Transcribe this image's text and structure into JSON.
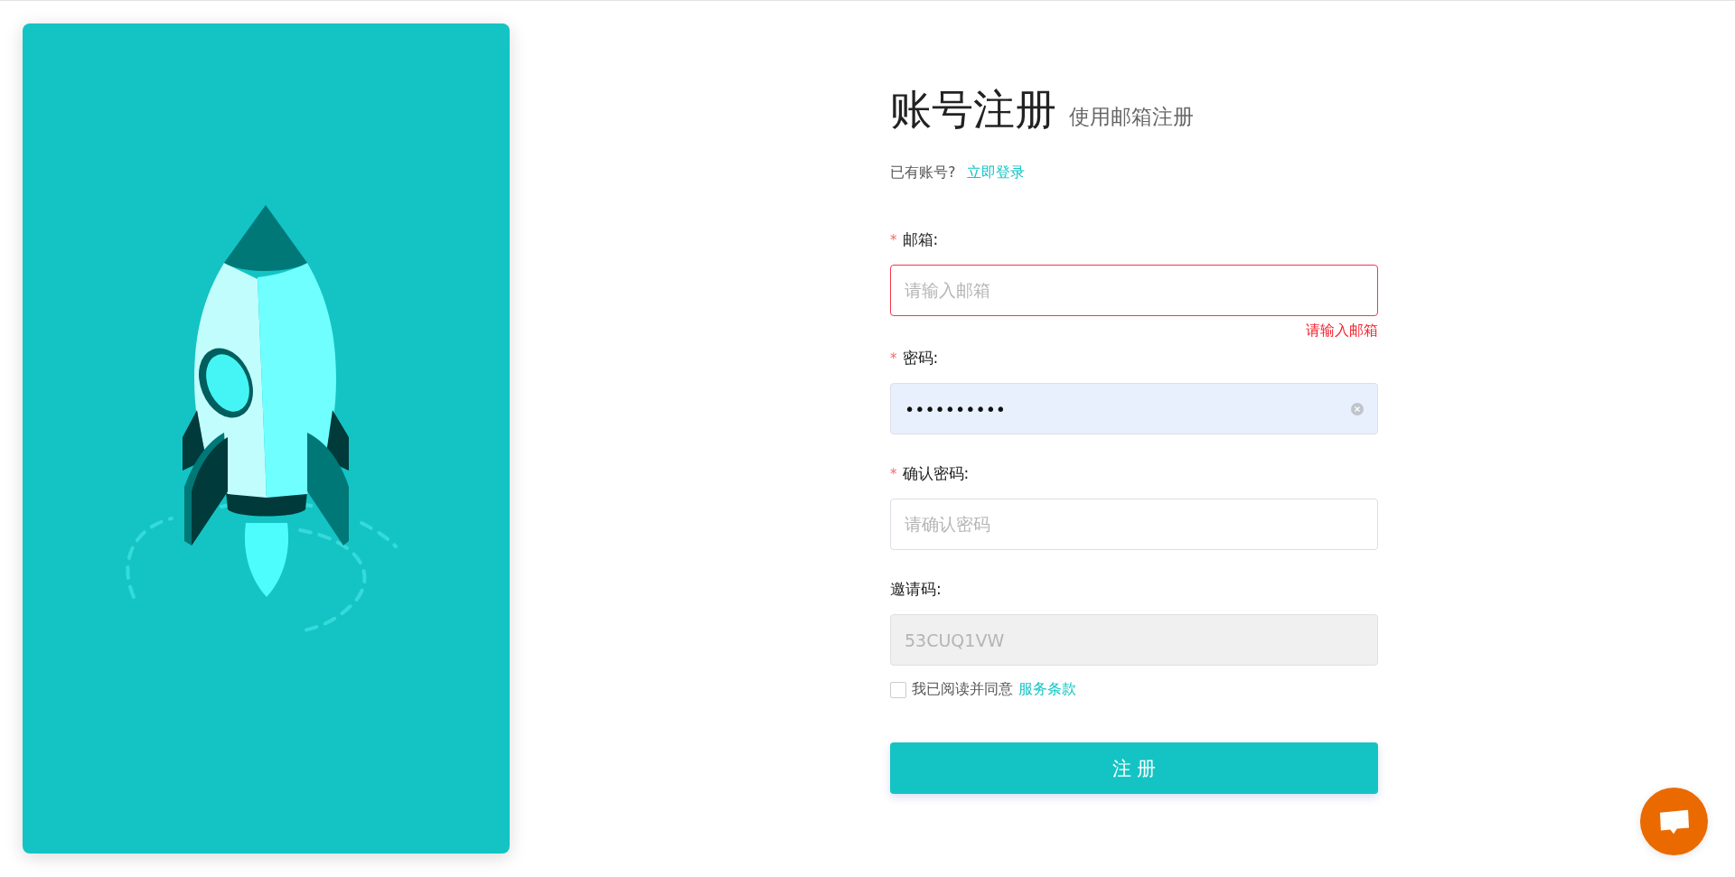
{
  "title": "账号注册",
  "subtitle": "使用邮箱注册",
  "login_prompt": {
    "text": "已有账号?",
    "link": "立即登录"
  },
  "fields": [
    {
      "label": "邮箱:",
      "marker": "*",
      "placeholder": "请输入邮箱",
      "invalid": true,
      "error": "请输入邮箱",
      "autofilled": false,
      "disabled": false,
      "clearable": false
    },
    {
      "label": "密码:",
      "marker": "*",
      "value": "••••••••••",
      "invalid": false,
      "autofilled": true,
      "disabled": false,
      "clearable": true
    },
    {
      "label": "确认密码:",
      "marker": "*",
      "placeholder": "请确认密码",
      "invalid": false,
      "autofilled": false,
      "disabled": false,
      "clearable": false
    },
    {
      "label": "邀请码:",
      "value": "53CUQ1VW",
      "invalid": false,
      "autofilled": false,
      "disabled": true,
      "clearable": false
    }
  ],
  "agreement": {
    "checked": false,
    "text": "我已阅读并同意",
    "link": "服务条款"
  },
  "submit": "注 册"
}
